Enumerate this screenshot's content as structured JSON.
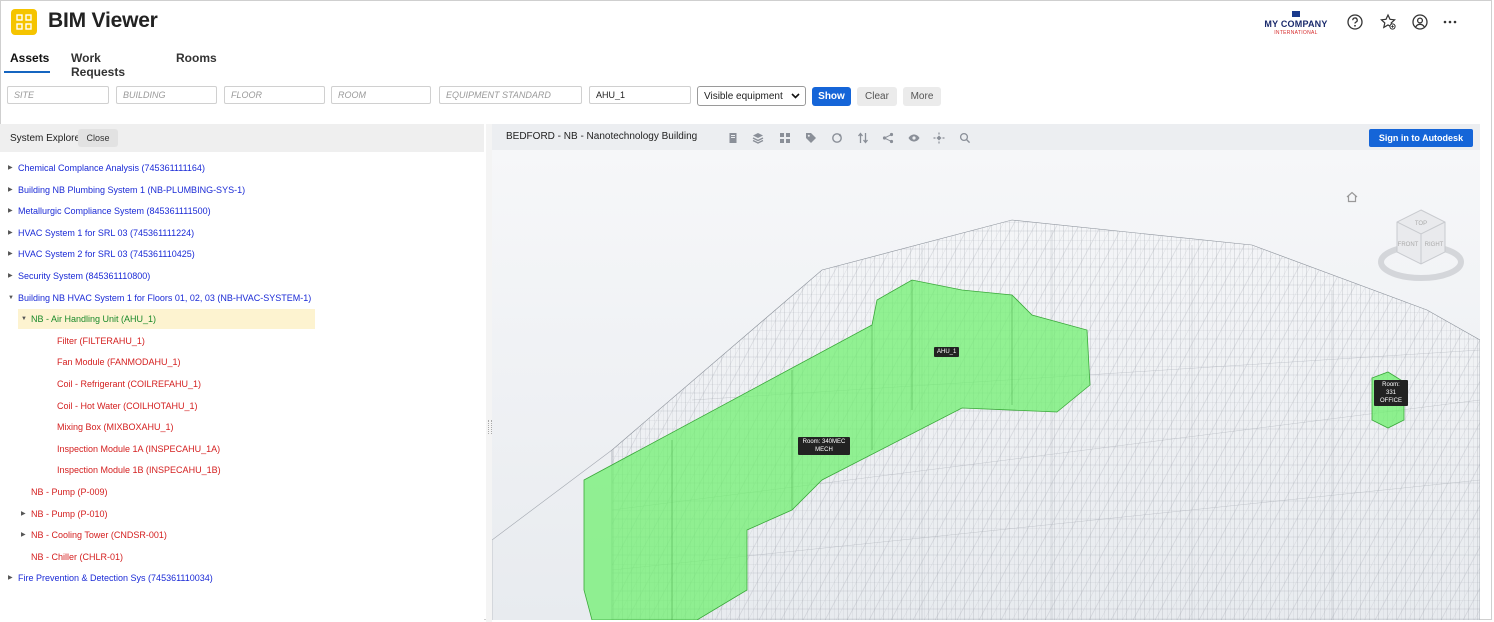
{
  "app": {
    "title": "BIM Viewer",
    "brand_color": "#f5c400",
    "accent": "#1565d8"
  },
  "company": {
    "name": "MY COMPANY",
    "subtitle": "INTERNATIONAL"
  },
  "header_icons": [
    "help-icon",
    "favorites-icon",
    "account-icon",
    "more-icon"
  ],
  "tabs": [
    {
      "label": "Assets",
      "active": true
    },
    {
      "label": "Work Requests",
      "active": false
    },
    {
      "label": "Rooms",
      "active": false
    }
  ],
  "filters": {
    "site": {
      "placeholder": "SITE",
      "value": ""
    },
    "building": {
      "placeholder": "BUILDING",
      "value": ""
    },
    "floor": {
      "placeholder": "FLOOR",
      "value": ""
    },
    "room": {
      "placeholder": "ROOM",
      "value": ""
    },
    "equipment_standard": {
      "placeholder": "EQUIPMENT STANDARD",
      "value": ""
    },
    "equipment": {
      "placeholder": "",
      "value": "AHU_1"
    },
    "visibility": {
      "selected": "Visible equipment"
    },
    "show_label": "Show",
    "clear_label": "Clear",
    "more_label": "More"
  },
  "system_explorer": {
    "title": "System Explorer",
    "close_label": "Close",
    "items": [
      {
        "label": "Chemical Complance Analysis (745361111164)",
        "level": 0,
        "caret": "▶"
      },
      {
        "label": "Building NB Plumbing System 1 (NB-PLUMBING-SYS-1)",
        "level": 0,
        "caret": "▶"
      },
      {
        "label": "Metallurgic Compliance System (845361111500)",
        "level": 0,
        "caret": "▶"
      },
      {
        "label": "HVAC System 1 for SRL 03 (745361111224)",
        "level": 0,
        "caret": "▶"
      },
      {
        "label": "HVAC System 2 for SRL 03 (745361110425)",
        "level": 0,
        "caret": "▶"
      },
      {
        "label": "Security System (845361110800)",
        "level": 0,
        "caret": "▶"
      },
      {
        "label": "Building NB HVAC System 1 for Floors 01, 02, 03 (NB-HVAC-SYSTEM-1)",
        "level": 0,
        "caret": "▼"
      },
      {
        "label": "NB - Air Handling Unit (AHU_1)",
        "level": 1,
        "caret": "▼",
        "selected": true
      },
      {
        "label": "Filter (FILTERAHU_1)",
        "level": 2,
        "caret": ""
      },
      {
        "label": "Fan Module (FANMODAHU_1)",
        "level": 2,
        "caret": ""
      },
      {
        "label": "Coil - Refrigerant (COILREFAHU_1)",
        "level": 2,
        "caret": ""
      },
      {
        "label": "Coil - Hot Water (COILHOTAHU_1)",
        "level": 2,
        "caret": ""
      },
      {
        "label": "Mixing Box (MIXBOXAHU_1)",
        "level": 2,
        "caret": ""
      },
      {
        "label": "Inspection Module 1A (INSPECAHU_1A)",
        "level": 2,
        "caret": ""
      },
      {
        "label": "Inspection Module 1B (INSPECAHU_1B)",
        "level": 2,
        "caret": ""
      },
      {
        "label": "NB - Pump (P-009)",
        "level": 1,
        "caret": ""
      },
      {
        "label": "NB - Pump (P-010)",
        "level": 1,
        "caret": "▶"
      },
      {
        "label": "NB - Cooling Tower (CNDSR-001)",
        "level": 1,
        "caret": "▶"
      },
      {
        "label": "NB - Chiller (CHLR-01)",
        "level": 1,
        "caret": ""
      },
      {
        "label": "Fire Prevention & Detection Sys (745361110034)",
        "level": 0,
        "caret": "▶"
      }
    ]
  },
  "viewer": {
    "title": "BEDFORD - NB - Nanotechnology Building",
    "sign_in_label": "Sign in to Autodesk",
    "toolbar_icons": [
      "document-icon",
      "layers-icon",
      "grid-icon",
      "tag-icon",
      "rotate-icon",
      "sort-icon",
      "share-icon",
      "eye-icon",
      "explode-icon",
      "search-icon"
    ],
    "viewcube": {
      "top": "TOP",
      "front": "FRONT",
      "right": "RIGHT"
    },
    "tags": {
      "ahu": "AHU_1",
      "room_mech_line1": "Room: 340MEC",
      "room_mech_line2": "MECH",
      "room_office_line1": "Room: 331",
      "room_office_line2": "OFFICE"
    }
  }
}
